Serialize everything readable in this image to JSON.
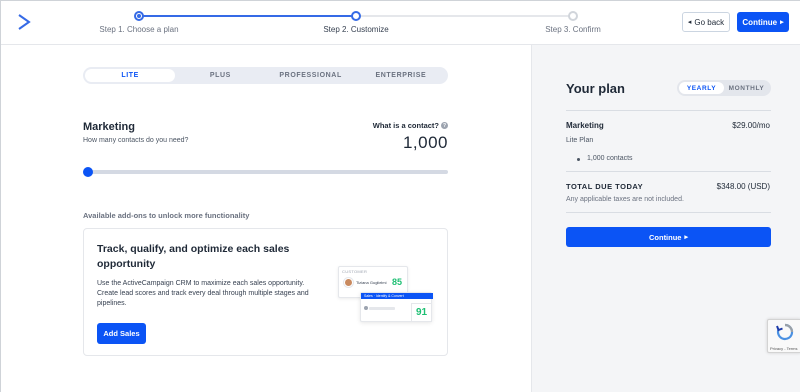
{
  "header": {
    "steps": [
      {
        "label": "Step 1. Choose a plan",
        "state": "done"
      },
      {
        "label": "Step 2. Customize",
        "state": "active"
      },
      {
        "label": "Step 3. Confirm",
        "state": "todo"
      }
    ],
    "back_label": "Go back",
    "continue_label": "Continue"
  },
  "plans": {
    "tabs": [
      {
        "label": "LITE",
        "active": true
      },
      {
        "label": "PLUS",
        "active": false
      },
      {
        "label": "PROFESSIONAL",
        "active": false
      },
      {
        "label": "ENTERPRISE",
        "active": false
      }
    ]
  },
  "marketing": {
    "title": "Marketing",
    "subtitle": "How many contacts do you need?",
    "what_is_contact": "What is a contact?",
    "contacts_value": "1,000",
    "slider_fraction": 0.0
  },
  "addons": {
    "label": "Available add-ons to unlock more functionality",
    "card": {
      "title": "Track, qualify, and optimize each sales opportunity",
      "description": "Use the ActiveCampaign CRM to maximize each sales opportunity. Create lead scores and track every deal through multiple stages and pipelines.",
      "button_label": "Add Sales",
      "illustration": {
        "header": "CUSTOMER",
        "name": "Tiziana Guglielmi",
        "score_a": "85",
        "bar_text": "Sales · Identify & Convert",
        "score_b": "91"
      }
    }
  },
  "summary": {
    "title": "Your plan",
    "billing": [
      {
        "label": "YEARLY",
        "active": true
      },
      {
        "label": "MONTHLY",
        "active": false
      }
    ],
    "line_item_name": "Marketing",
    "line_item_price": "$29.00/mo",
    "line_item_plan": "Lite Plan",
    "line_item_detail": "1,000 contacts",
    "total_label": "TOTAL DUE TODAY",
    "total_value": "$348.00 (USD)",
    "tax_note": "Any applicable taxes are not included.",
    "continue_label": "Continue"
  },
  "recaptcha": {
    "text": "Privacy - Terms"
  },
  "colors": {
    "accent": "#0b54f5",
    "step_accent": "#356ae6",
    "score_green": "#1dbf73"
  }
}
